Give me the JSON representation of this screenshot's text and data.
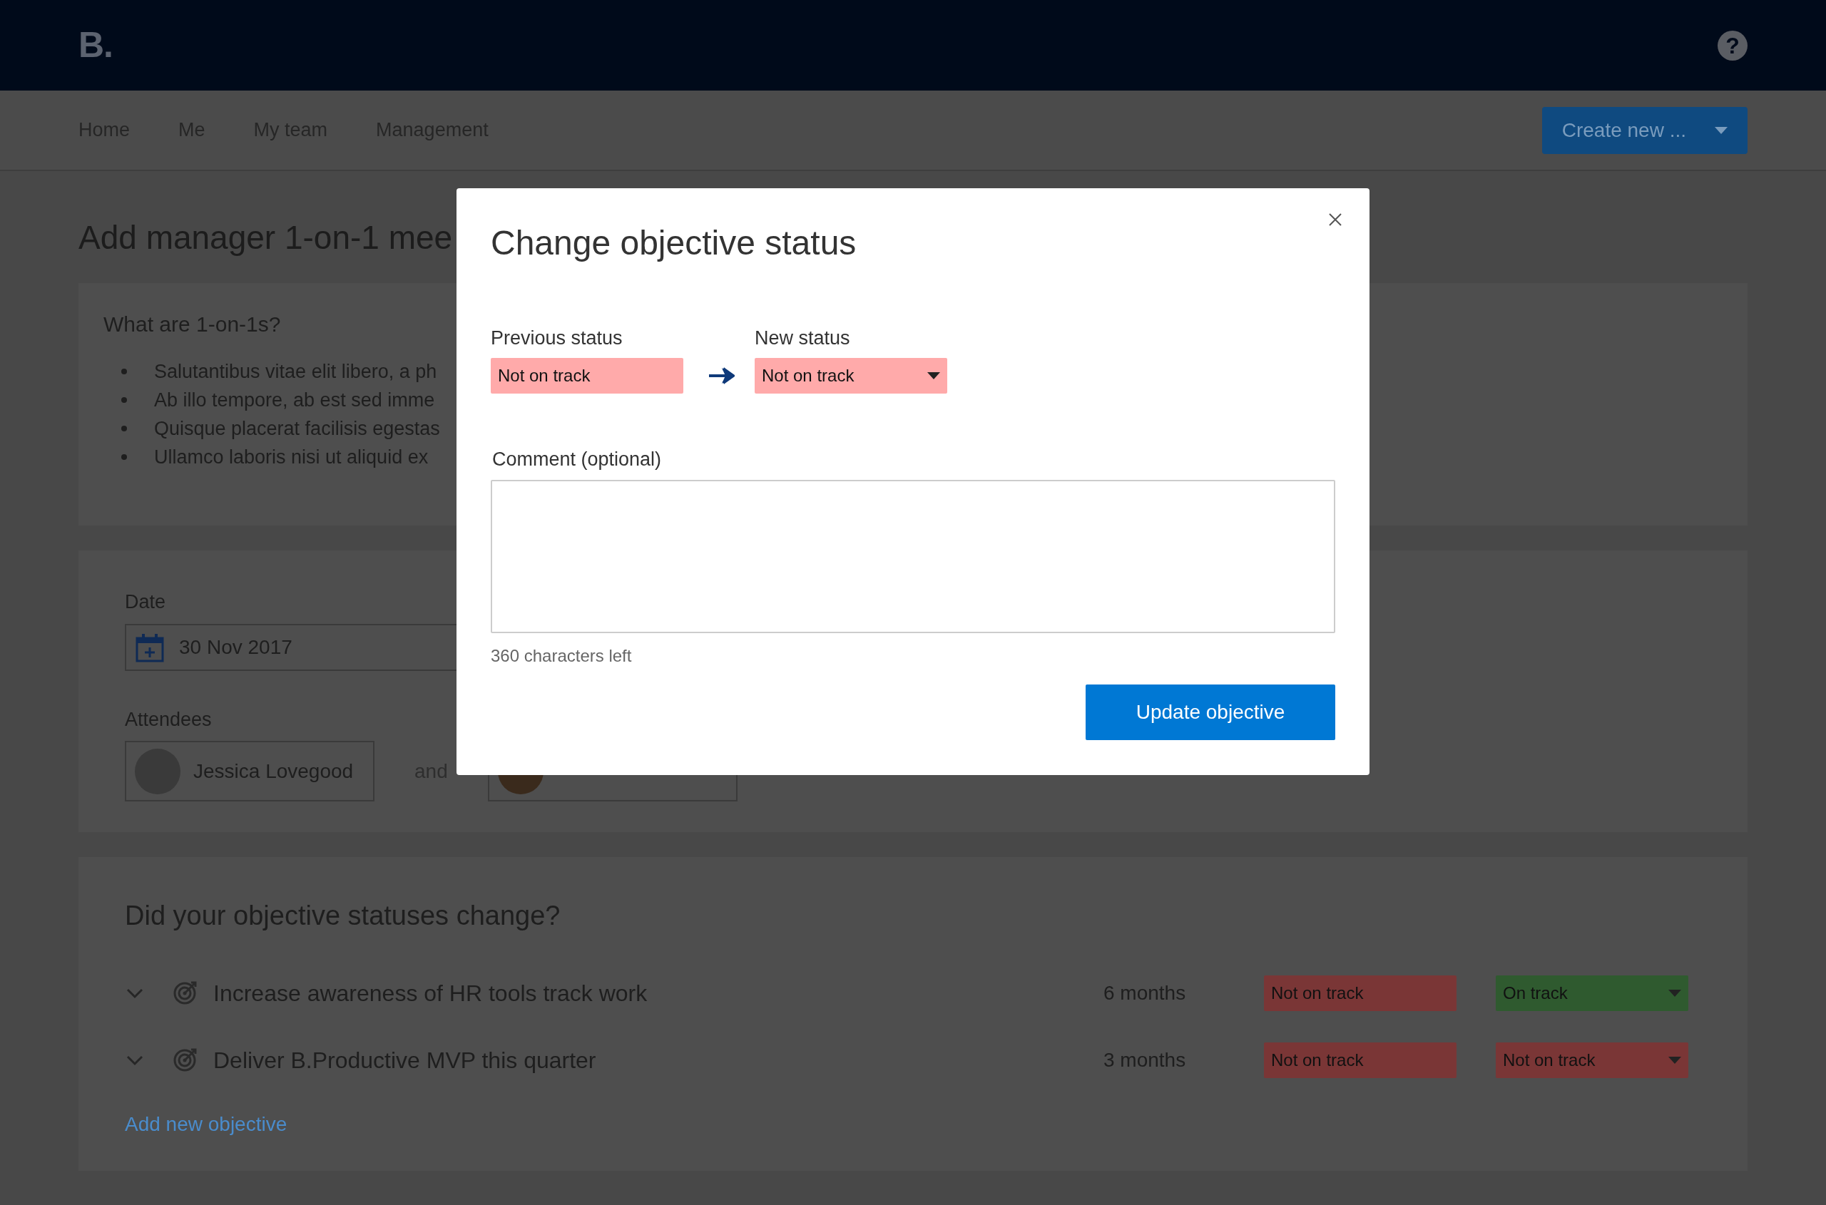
{
  "header": {
    "logo": "B.",
    "help": "?"
  },
  "nav": {
    "items": [
      {
        "label": "Home"
      },
      {
        "label": "Me"
      },
      {
        "label": "My team"
      },
      {
        "label": "Management"
      }
    ],
    "create_button": "Create new ..."
  },
  "page": {
    "title": "Add manager 1-on-1 mee"
  },
  "info_card": {
    "title": "What are 1-on-1s?",
    "bullets": [
      "Salutantibus vitae elit libero, a ph",
      "Ab illo tempore, ab est sed imme",
      "Quisque placerat facilisis egestas",
      "Ullamco laboris nisi ut aliquid ex"
    ]
  },
  "meeting_card": {
    "date_label": "Date",
    "date": "30 Nov 2017",
    "attendees_label": "Attendees",
    "attendees": [
      {
        "name": "Jessica Lovegood"
      },
      {
        "kind": "covered"
      }
    ],
    "joiner": "and"
  },
  "objectives_card": {
    "title": "Did your objective statuses change?",
    "objectives": [
      {
        "title": "Increase awareness of HR tools track work",
        "duration": "6 months",
        "previous_status": {
          "label": "Not on track",
          "kind": "not_on_track"
        },
        "new_status": {
          "label": "On track",
          "kind": "on_track"
        }
      },
      {
        "title": "Deliver B.Productive MVP this quarter",
        "duration": "3 months",
        "previous_status": {
          "label": "Not on track",
          "kind": "not_on_track"
        },
        "new_status": {
          "label": "Not on track",
          "kind": "not_on_track"
        }
      }
    ],
    "add_link": "Add new objective"
  },
  "modal": {
    "title": "Change objective status",
    "previous_label": "Previous status",
    "previous_status": {
      "label": "Not on track",
      "kind": "not_on_track"
    },
    "new_label": "New status",
    "new_status": {
      "label": "Not on track",
      "kind": "not_on_track"
    },
    "comment_label": "Comment (optional)",
    "counter": "360 characters left",
    "submit": "Update objective"
  }
}
